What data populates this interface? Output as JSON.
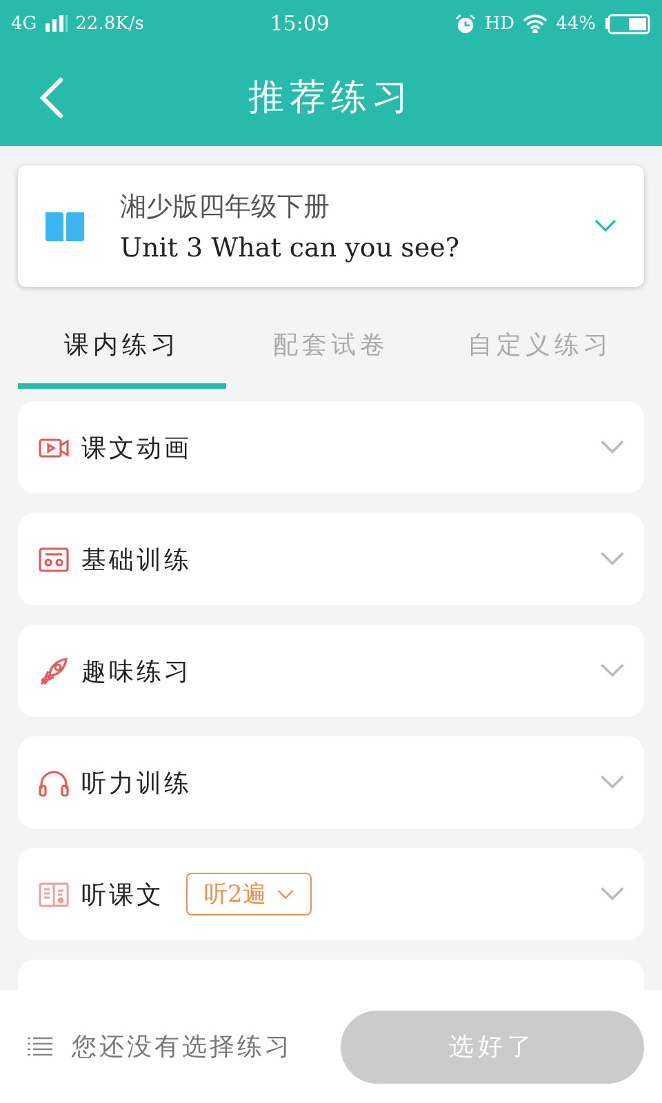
{
  "status_bar": {
    "network": "4G",
    "speed": "22.8K/s",
    "time": "15:09",
    "hd": "HD",
    "battery": "44%"
  },
  "header": {
    "title": "推荐练习"
  },
  "book": {
    "edition": "湘少版四年级下册",
    "unit": "Unit 3 What can you see?"
  },
  "tabs": [
    {
      "label": "课内练习",
      "selected": true
    },
    {
      "label": "配套试卷",
      "selected": false
    },
    {
      "label": "自定义练习",
      "selected": false
    }
  ],
  "sections": [
    {
      "kind": "video",
      "label": "课文动画",
      "expanded": false
    },
    {
      "kind": "cassette",
      "label": "基础训练",
      "expanded": false
    },
    {
      "kind": "rocket",
      "label": "趣味练习",
      "expanded": false
    },
    {
      "kind": "headphones",
      "label": "听力训练",
      "expanded": false
    },
    {
      "kind": "reading",
      "label": "听课文",
      "expanded": false,
      "repeat": "听2遍"
    }
  ],
  "bottom_bar": {
    "hint": "您还没有选择练习",
    "button": {
      "label": "选好了",
      "disabled": true
    }
  }
}
